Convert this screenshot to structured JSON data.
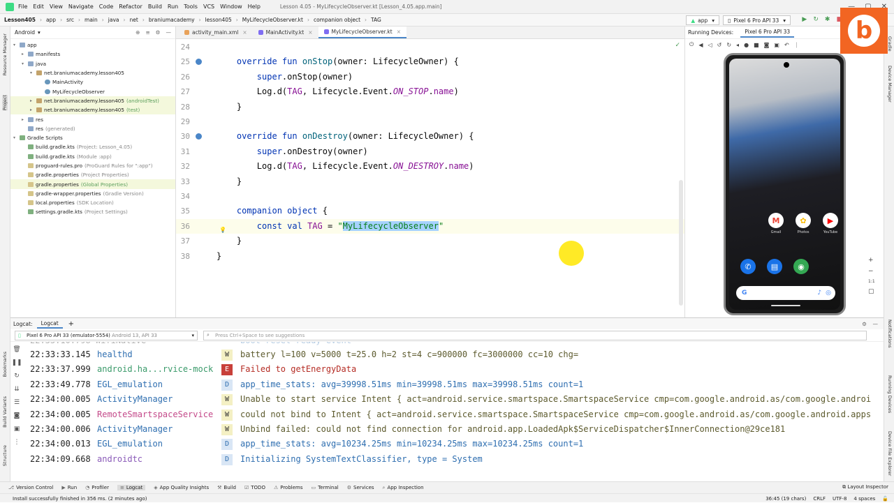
{
  "menubar": {
    "items": [
      "File",
      "Edit",
      "View",
      "Navigate",
      "Code",
      "Refactor",
      "Build",
      "Run",
      "Tools",
      "VCS",
      "Window",
      "Help"
    ],
    "title": "Lesson 4.05 - MyLifecycleObserver.kt [Lesson_4.05.app.main]"
  },
  "breadcrumb": [
    "Lesson405",
    "app",
    "src",
    "main",
    "java",
    "net",
    "braniumacademy",
    "lesson405",
    "MyLifecycleObserver.kt",
    "companion object",
    "TAG"
  ],
  "toolbar": {
    "run_config": "app",
    "device": "Pixel 6 Pro API 33"
  },
  "project": {
    "view": "Android",
    "nodes": [
      {
        "label": "app",
        "hint": "",
        "indent": 0,
        "icon": "folder",
        "arrow": "▾",
        "hl": false
      },
      {
        "label": "manifests",
        "hint": "",
        "indent": 1,
        "icon": "folder",
        "arrow": "▸",
        "hl": false
      },
      {
        "label": "java",
        "hint": "",
        "indent": 1,
        "icon": "folder",
        "arrow": "▾",
        "hl": false
      },
      {
        "label": "net.braniumacademy.lesson405",
        "hint": "",
        "indent": 2,
        "icon": "pkg",
        "arrow": "▾",
        "hl": false
      },
      {
        "label": "MainActivity",
        "hint": "",
        "indent": 3,
        "icon": "kfile",
        "arrow": "",
        "hl": false
      },
      {
        "label": "MyLifecycleObserver",
        "hint": "",
        "indent": 3,
        "icon": "kfile",
        "arrow": "",
        "hl": false
      },
      {
        "label": "net.braniumacademy.lesson405",
        "hint": "(androidTest)",
        "indent": 2,
        "icon": "pkg",
        "arrow": "▸",
        "hl": true
      },
      {
        "label": "net.braniumacademy.lesson405",
        "hint": "(test)",
        "indent": 2,
        "icon": "pkg",
        "arrow": "▸",
        "hl": true
      },
      {
        "label": "res",
        "hint": "",
        "indent": 1,
        "icon": "folder",
        "arrow": "▸",
        "hl": false
      },
      {
        "label": "res",
        "hint": "(generated)",
        "indent": 1,
        "icon": "folder",
        "arrow": "",
        "hl": false
      },
      {
        "label": "Gradle Scripts",
        "hint": "",
        "indent": 0,
        "icon": "gfile",
        "arrow": "▾",
        "hl": false
      },
      {
        "label": "build.gradle.kts",
        "hint": "(Project: Lesson_4.05)",
        "indent": 1,
        "icon": "gfile",
        "arrow": "",
        "hl": false
      },
      {
        "label": "build.gradle.kts",
        "hint": "(Module :app)",
        "indent": 1,
        "icon": "gfile",
        "arrow": "",
        "hl": false
      },
      {
        "label": "proguard-rules.pro",
        "hint": "(ProGuard Rules for \":app\")",
        "indent": 1,
        "icon": "gen",
        "arrow": "",
        "hl": false
      },
      {
        "label": "gradle.properties",
        "hint": "(Project Properties)",
        "indent": 1,
        "icon": "gen",
        "arrow": "",
        "hl": false
      },
      {
        "label": "gradle.properties",
        "hint": "(Global Properties)",
        "indent": 1,
        "icon": "gen",
        "arrow": "",
        "hl": true
      },
      {
        "label": "gradle-wrapper.properties",
        "hint": "(Gradle Version)",
        "indent": 1,
        "icon": "gen",
        "arrow": "",
        "hl": false
      },
      {
        "label": "local.properties",
        "hint": "(SDK Location)",
        "indent": 1,
        "icon": "gen",
        "arrow": "",
        "hl": false
      },
      {
        "label": "settings.gradle.kts",
        "hint": "(Project Settings)",
        "indent": 1,
        "icon": "gfile",
        "arrow": "",
        "hl": false
      }
    ]
  },
  "editor": {
    "tabs": [
      "activity_main.xml",
      "MainActivity.kt",
      "MyLifecycleObserver.kt"
    ],
    "active_tab": 2,
    "lines": [
      {
        "n": "24",
        "html": ""
      },
      {
        "n": "25",
        "html": "    <span class=\"kw\">override fun</span> <span class=\"fn\">onStop</span>(owner: LifecycleOwner) {",
        "gicon": true
      },
      {
        "n": "26",
        "html": "        <span class=\"kw\">super</span>.onStop(owner)"
      },
      {
        "n": "27",
        "html": "        Log.d(<span class=\"cn\" style=\"font-style:normal\">TAG</span>, Lifecycle.Event.<span class=\"cn\">ON_STOP</span>.<span class=\"cn\" style=\"font-style:normal\">name</span>)"
      },
      {
        "n": "28",
        "html": "    }"
      },
      {
        "n": "29",
        "html": ""
      },
      {
        "n": "30",
        "html": "    <span class=\"kw\">override fun</span> <span class=\"fn\">onDestroy</span>(owner: LifecycleOwner) {",
        "gicon": true
      },
      {
        "n": "31",
        "html": "        <span class=\"kw\">super</span>.onDestroy(owner)"
      },
      {
        "n": "32",
        "html": "        Log.d(<span class=\"cn\" style=\"font-style:normal\">TAG</span>, Lifecycle.Event.<span class=\"cn\">ON_DESTROY</span>.<span class=\"cn\" style=\"font-style:normal\">name</span>)"
      },
      {
        "n": "33",
        "html": "    }"
      },
      {
        "n": "34",
        "html": ""
      },
      {
        "n": "35",
        "html": "    <span class=\"kw\">companion object</span> {"
      },
      {
        "n": "36",
        "html": "        <span class=\"kw\">const val</span> <span class=\"cn\" style=\"font-style:normal\">TAG</span> = <span class=\"st\">\"<span class=\"sel\">MyLifecycleObserver</span>\"</span>",
        "cur": true,
        "bulb": true
      },
      {
        "n": "37",
        "html": "    }"
      },
      {
        "n": "38",
        "html": "}"
      }
    ]
  },
  "emulator": {
    "label": "Running Devices:",
    "tab": "Pixel 6 Pro API 33",
    "apps": [
      {
        "name": "Gmail",
        "glyph": "M",
        "color": "#ea4335"
      },
      {
        "name": "Photos",
        "glyph": "✿",
        "color": "#fbbc05"
      },
      {
        "name": "YouTube",
        "glyph": "▶",
        "color": "#ff0000"
      }
    ],
    "dock": [
      {
        "glyph": "✆",
        "color": "#1a73e8"
      },
      {
        "glyph": "▤",
        "color": "#1a73e8"
      },
      {
        "glyph": "◉",
        "color": "#34a853"
      }
    ],
    "zoom": [
      "+",
      "−",
      "1:1",
      "▢"
    ]
  },
  "logcat": {
    "label": "Logcat:",
    "tab": "Logcat",
    "device": "Pixel 6 Pro API 33 (emulator-5554)",
    "device_hint": "Android 13, API 33",
    "filter_placeholder": "Press Ctrl+Space to see suggestions",
    "rows": [
      {
        "ts": "22:33:33.145",
        "tag": "healthd",
        "tagcolor": "#2e6eb0",
        "lvl": "W",
        "msg": "battery l=100 v=5000 t=25.0 h=2 st=4 c=900000 fc=3000000 cc=10 chg="
      },
      {
        "ts": "22:33:37.999",
        "tag": "android.ha...rvice-mock",
        "tagcolor": "#3a9a6a",
        "lvl": "E",
        "msg": "Failed to getEnergyData"
      },
      {
        "ts": "22:33:49.778",
        "tag": "EGL_emulation",
        "tagcolor": "#2e6eb0",
        "lvl": "D",
        "msg": "app_time_stats: avg=39998.51ms min=39998.51ms max=39998.51ms count=1"
      },
      {
        "ts": "22:34:00.005",
        "tag": "ActivityManager",
        "tagcolor": "#2e6eb0",
        "lvl": "W",
        "msg": "Unable to start service Intent { act=android.service.smartspace.SmartspaceService cmp=com.google.android.as/com.google.androi"
      },
      {
        "ts": "22:34:00.005",
        "tag": "RemoteSmartspaceService",
        "tagcolor": "#c44a8a",
        "lvl": "W",
        "msg": "could not bind to Intent { act=android.service.smartspace.SmartspaceService cmp=com.google.android.as/com.google.android.apps"
      },
      {
        "ts": "22:34:00.006",
        "tag": "ActivityManager",
        "tagcolor": "#2e6eb0",
        "lvl": "W",
        "msg": "Unbind failed: could not find connection for android.app.LoadedApk$ServiceDispatcher$InnerConnection@29ce181"
      },
      {
        "ts": "22:34:00.013",
        "tag": "EGL_emulation",
        "tagcolor": "#2e6eb0",
        "lvl": "D",
        "msg": "app_time_stats: avg=10234.25ms min=10234.25ms max=10234.25ms count=1"
      },
      {
        "ts": "22:34:09.668",
        "tag": "androidtc",
        "tagcolor": "#8a5ab8",
        "lvl": "D",
        "msg": "Initializing SystemTextClassifier, type = System"
      }
    ]
  },
  "bottom": {
    "tools": [
      "Version Control",
      "Run",
      "Profiler",
      "Logcat",
      "App Quality Insights",
      "Build",
      "TODO",
      "Problems",
      "Terminal",
      "Services",
      "App Inspection"
    ],
    "layout_inspector": "Layout Inspector",
    "status": "Install successfully finished in 356 ms. (2 minutes ago)",
    "right": [
      "36:45 (19 chars)",
      "CRLF",
      "UTF-8",
      "4 spaces"
    ]
  },
  "left_strip": [
    "Resource Manager",
    "Project",
    "Bookmarks",
    "Build Variants",
    "Structure"
  ],
  "right_strip": [
    "Gradle",
    "Device Manager",
    "Notifications",
    "Running Devices",
    "Device File Explorer"
  ]
}
